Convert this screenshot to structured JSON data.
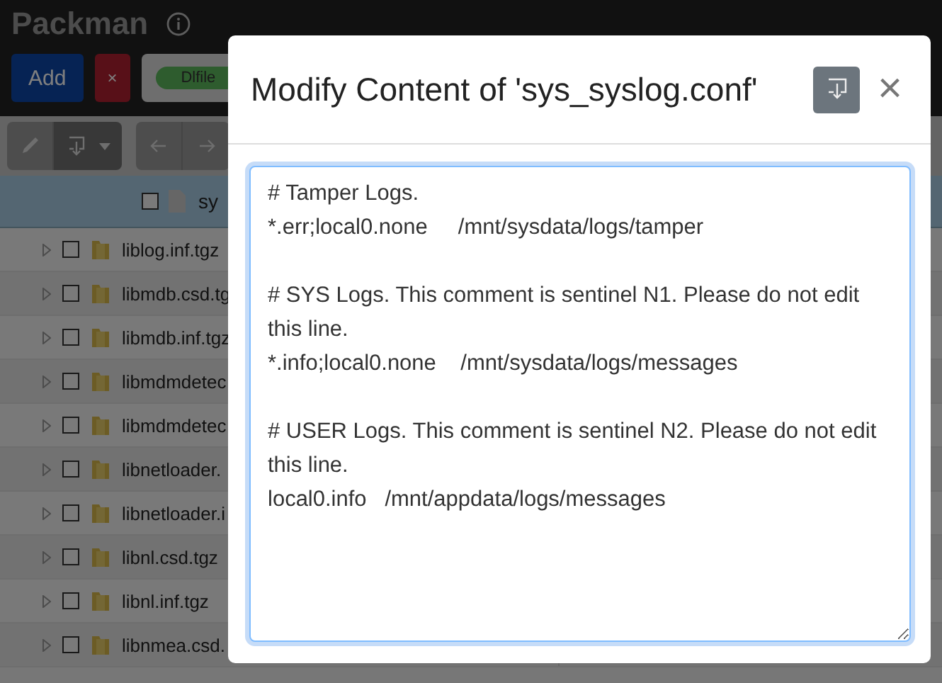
{
  "app": {
    "title": "Packman"
  },
  "header_buttons": [
    {
      "label": "Add",
      "kind": "primary"
    },
    {
      "label": "×",
      "kind": "danger"
    }
  ],
  "filter_tag": {
    "label": "Dlfile"
  },
  "table": {
    "header": "sy",
    "all_checked": false,
    "rows": [
      {
        "name": "liblog.inf.tgz",
        "checked": false
      },
      {
        "name": "libmdb.csd.tg",
        "checked": false
      },
      {
        "name": "libmdb.inf.tgz",
        "checked": false
      },
      {
        "name": "libmdmdetec",
        "checked": false
      },
      {
        "name": "libmdmdetec",
        "checked": false
      },
      {
        "name": "libnetloader.",
        "checked": false
      },
      {
        "name": "libnetloader.i",
        "checked": false
      },
      {
        "name": "libnl.csd.tgz",
        "checked": false
      },
      {
        "name": "libnl.inf.tgz",
        "checked": false
      },
      {
        "name": "libnmea.csd.",
        "checked": false
      }
    ]
  },
  "dialog": {
    "title": "Modify Content of 'sys_syslog.conf'",
    "close": "×",
    "content": "# Tamper Logs.\n*.err;local0.none     /mnt/sysdata/logs/tamper\n\n# SYS Logs. This comment is sentinel N1. Please do not edit this line.\n*.info;local0.none    /mnt/sysdata/logs/messages\n\n# USER Logs. This comment is sentinel N2. Please do not edit this line.\nlocal0.info   /mnt/appdata/logs/messages"
  }
}
